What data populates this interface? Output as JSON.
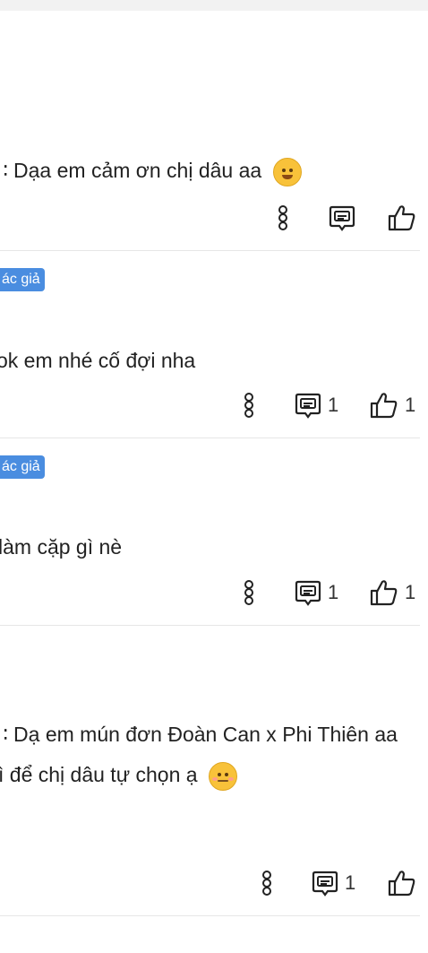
{
  "comments": [
    {
      "lines": [
        "∷ Dạa em cảm ơn chị dâu aa"
      ],
      "emoji": "smiling-hearts-emoji",
      "badge": "",
      "reply_count": "",
      "like_count": ""
    },
    {
      "badge": "ác giả",
      "lines": [
        "ok em nhé cố đợi nha"
      ],
      "reply_count": "1",
      "like_count": "1"
    },
    {
      "badge": "ác giả",
      "lines": [
        "làm cặp gì nè"
      ],
      "reply_count": "1",
      "like_count": "1"
    },
    {
      "lines": [
        "∷ Dạ em mún đơn Đoàn Can x Phi Thiên aa",
        "ì để chị dâu tự chọn ạ"
      ],
      "emoji": "shy-face-emoji",
      "reply_count": "1",
      "like_count": ""
    }
  ],
  "icons": {
    "more": "more-vertical-icon",
    "reply": "reply-bubble-icon",
    "like": "thumbs-up-icon"
  },
  "colors": {
    "badge_bg": "#4a8de0",
    "divider": "#e6e6e6",
    "text": "#222222",
    "topbar": "#f2f2f2"
  }
}
